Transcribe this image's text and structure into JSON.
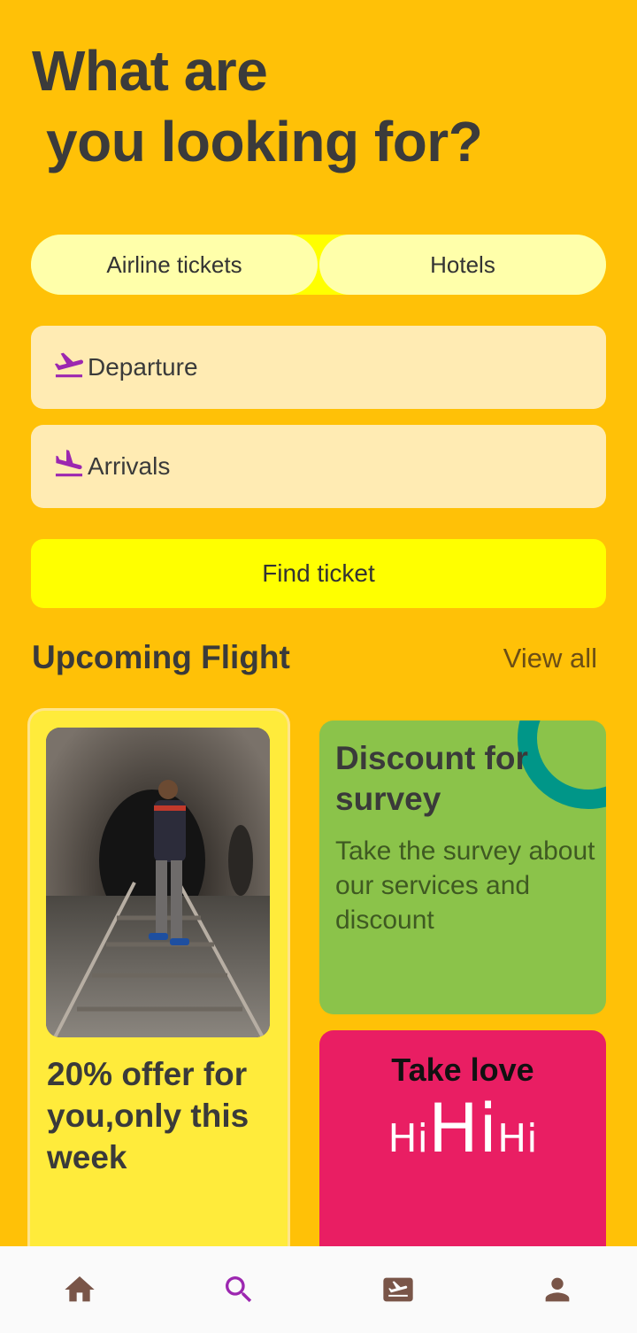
{
  "header": {
    "title_line1": "What are",
    "title_line2": "you looking for?"
  },
  "tabs": [
    {
      "label": "Airline tickets"
    },
    {
      "label": "Hotels"
    }
  ],
  "form": {
    "departure_label": "Departure",
    "arrivals_label": "Arrivals",
    "find_button": "Find ticket"
  },
  "upcoming": {
    "title": "Upcoming Flight",
    "view_all": "View all"
  },
  "cards": {
    "offer": {
      "text": "20% offer for you,only this week"
    },
    "survey": {
      "title": "Discount for survey",
      "description": "Take the survey about our services and discount"
    },
    "love": {
      "title": "Take love",
      "hi_small_left": "Hi",
      "hi_big": "Hi",
      "hi_small_right": "Hi"
    }
  },
  "bottom_nav": [
    {
      "name": "home-icon",
      "active": false
    },
    {
      "name": "search-icon",
      "active": true
    },
    {
      "name": "ticket-icon",
      "active": false
    },
    {
      "name": "person-icon",
      "active": false
    }
  ],
  "colors": {
    "background": "#FFC107",
    "accent_icon": "#9C27B0",
    "nav_icon": "#795548",
    "survey_card": "#8BC34A",
    "love_card": "#E91E63",
    "offer_card": "#FFEB3B",
    "find_button": "#FFFF00"
  }
}
